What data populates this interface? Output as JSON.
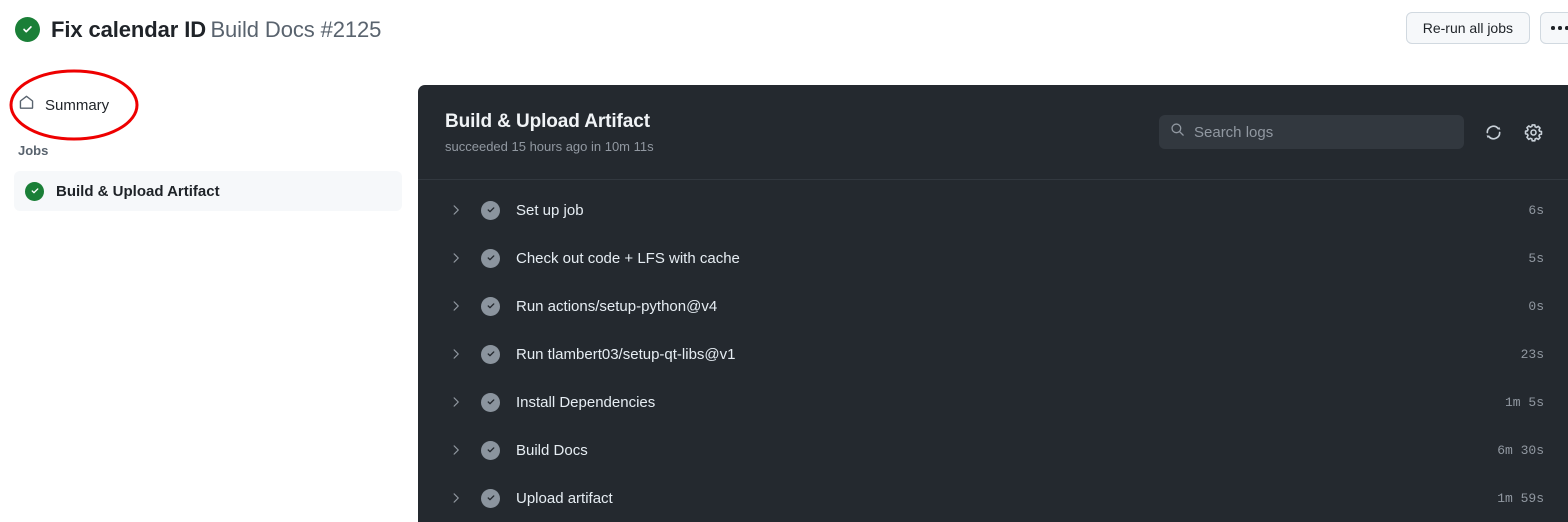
{
  "topbar": {
    "status_icon": "check-circle-icon",
    "run_title": "Fix calendar ID",
    "run_subtitle": "Build Docs #2125",
    "rerun_label": "Re-run all jobs",
    "kebab_label": "···",
    "status_color": "#1a7f37"
  },
  "sidebar": {
    "summary": {
      "icon": "home-icon",
      "label": "Summary"
    },
    "jobs_heading": "Jobs",
    "jobs": [
      {
        "label": "Build & Upload Artifact",
        "status": "success",
        "status_color": "#1a7f37",
        "selected": true
      }
    ]
  },
  "annotation": {
    "shape": "ellipse",
    "color": "#ee0000",
    "target": "Summary"
  },
  "log_panel": {
    "title": "Build & Upload Artifact",
    "meta": "succeeded 15 hours ago in 10m 11s",
    "search": {
      "placeholder": "Search logs",
      "value": "",
      "icon": "search-icon"
    },
    "refresh_icon": "refresh-icon",
    "settings_icon": "gear-icon",
    "background": "#24292f",
    "steps": [
      {
        "name": "Set up job",
        "duration": "6s",
        "status": "success"
      },
      {
        "name": "Check out code + LFS with cache",
        "duration": "5s",
        "status": "success"
      },
      {
        "name": "Run actions/setup-python@v4",
        "duration": "0s",
        "status": "success"
      },
      {
        "name": "Run tlambert03/setup-qt-libs@v1",
        "duration": "23s",
        "status": "success"
      },
      {
        "name": "Install Dependencies",
        "duration": "1m 5s",
        "status": "success"
      },
      {
        "name": "Build Docs",
        "duration": "6m 30s",
        "status": "success"
      },
      {
        "name": "Upload artifact",
        "duration": "1m 59s",
        "status": "success"
      }
    ]
  }
}
